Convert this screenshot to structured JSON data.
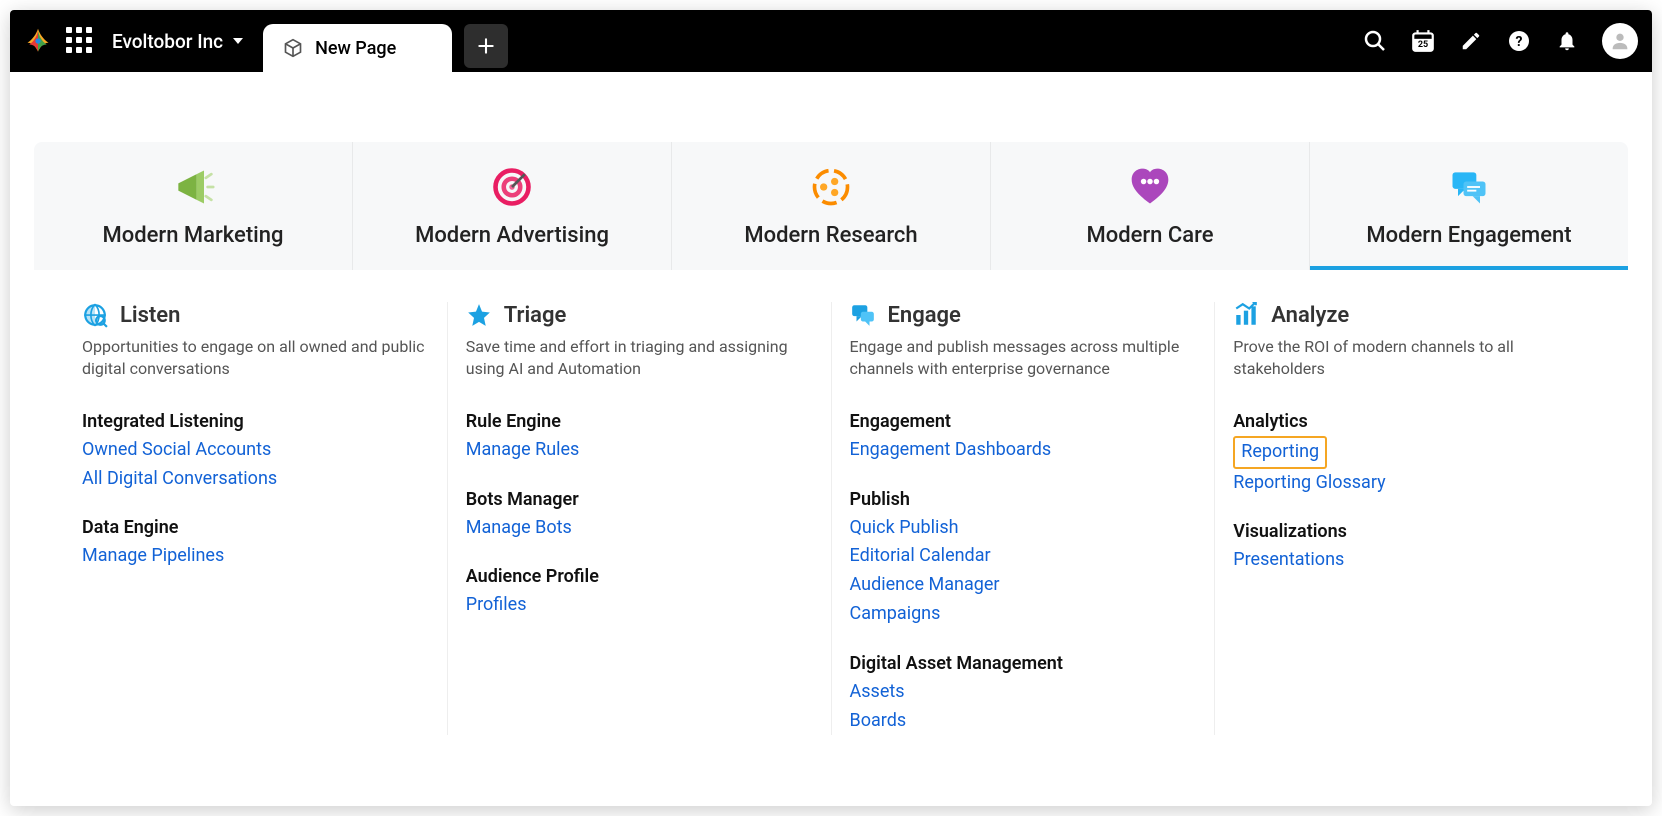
{
  "header": {
    "org_name": "Evoltobor Inc",
    "tab_label": "New Page",
    "calendar_badge": "25"
  },
  "modules": [
    {
      "id": "marketing",
      "label": "Modern Marketing"
    },
    {
      "id": "advertising",
      "label": "Modern Advertising"
    },
    {
      "id": "research",
      "label": "Modern Research"
    },
    {
      "id": "care",
      "label": "Modern Care"
    },
    {
      "id": "engagement",
      "label": "Modern Engagement",
      "active": true
    }
  ],
  "columns": [
    {
      "id": "listen",
      "title": "Listen",
      "desc": "Opportunities to engage on all owned and public digital conversations",
      "groups": [
        {
          "title": "Integrated Listening",
          "links": [
            "Owned Social Accounts",
            "All Digital Conversations"
          ]
        },
        {
          "title": "Data Engine",
          "links": [
            "Manage Pipelines"
          ]
        }
      ]
    },
    {
      "id": "triage",
      "title": "Triage",
      "desc": "Save time and effort in triaging and assigning using AI and Automation",
      "groups": [
        {
          "title": "Rule Engine",
          "links": [
            "Manage Rules"
          ]
        },
        {
          "title": "Bots Manager",
          "links": [
            "Manage Bots"
          ]
        },
        {
          "title": "Audience Profile",
          "links": [
            "Profiles"
          ]
        }
      ]
    },
    {
      "id": "engage",
      "title": "Engage",
      "desc": "Engage and publish messages across multiple channels with enterprise governance",
      "groups": [
        {
          "title": "Engagement",
          "links": [
            "Engagement Dashboards"
          ]
        },
        {
          "title": "Publish",
          "links": [
            "Quick Publish",
            "Editorial Calendar",
            "Audience Manager",
            "Campaigns"
          ]
        },
        {
          "title": "Digital Asset Management",
          "links": [
            "Assets",
            "Boards"
          ]
        }
      ]
    },
    {
      "id": "analyze",
      "title": "Analyze",
      "desc": "Prove the ROI of modern channels to all stakeholders",
      "groups": [
        {
          "title": "Analytics",
          "links": [
            "Reporting",
            "Reporting Glossary"
          ],
          "highlight_index": 0
        },
        {
          "title": "Visualizations",
          "links": [
            "Presentations"
          ]
        }
      ]
    }
  ]
}
